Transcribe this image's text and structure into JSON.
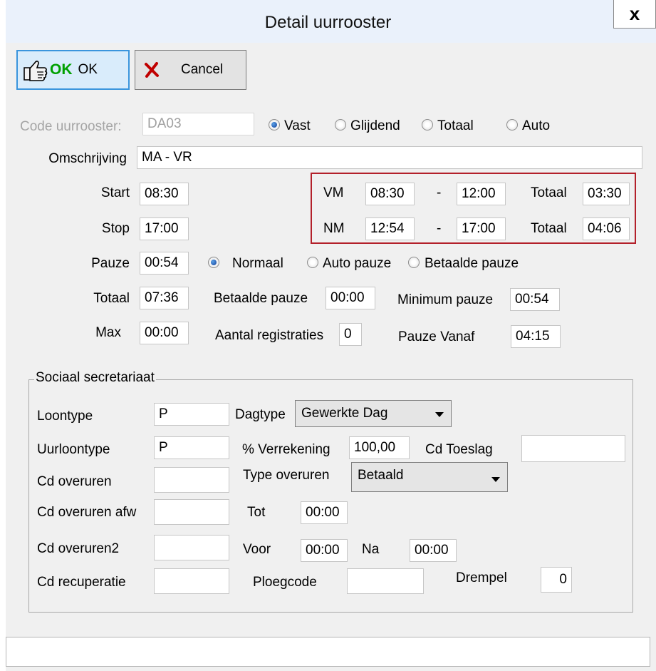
{
  "window": {
    "title": "Detail uurrooster",
    "close": "x"
  },
  "toolbar": {
    "ok_icon_text": "OK",
    "ok_label": "OK",
    "cancel_label": "Cancel"
  },
  "code": {
    "label": "Code uurrooster:",
    "value": "DA03",
    "modes": [
      "Vast",
      "Glijdend",
      "Totaal",
      "Auto"
    ],
    "selected_mode": "Vast"
  },
  "omschrijving": {
    "label": "Omschrijving",
    "value": "MA - VR"
  },
  "start": {
    "label": "Start",
    "value": "08:30"
  },
  "stop": {
    "label": "Stop",
    "value": "17:00"
  },
  "vm": {
    "label": "VM",
    "from": "08:30",
    "sep": "-",
    "to": "12:00",
    "totaal_label": "Totaal",
    "totaal": "03:30"
  },
  "nm": {
    "label": "NM",
    "from": "12:54",
    "sep": "-",
    "to": "17:00",
    "totaal_label": "Totaal",
    "totaal": "04:06"
  },
  "pauze": {
    "label": "Pauze",
    "value": "00:54",
    "options": [
      "Normaal",
      "Auto pauze",
      "Betaalde pauze"
    ],
    "selected": "Normaal"
  },
  "totaal": {
    "label": "Totaal",
    "value": "07:36"
  },
  "betaalde_pauze": {
    "label": "Betaalde pauze",
    "value": "00:00"
  },
  "minimum_pauze": {
    "label": "Minimum pauze",
    "value": "00:54"
  },
  "max": {
    "label": "Max",
    "value": "00:00"
  },
  "aantal_registraties": {
    "label": "Aantal registraties",
    "value": "0"
  },
  "pauze_vanaf": {
    "label": "Pauze Vanaf",
    "value": "04:15"
  },
  "sociaal": {
    "title": "Sociaal secretariaat",
    "loontype": {
      "label": "Loontype",
      "value": "P"
    },
    "dagtype": {
      "label": "Dagtype",
      "value": "Gewerkte Dag"
    },
    "uurloontype": {
      "label": "Uurloontype",
      "value": "P"
    },
    "verrekening": {
      "label": "% Verrekening",
      "value": "100,00"
    },
    "cd_toeslag": {
      "label": "Cd Toeslag",
      "value": ""
    },
    "cd_overuren": {
      "label": "Cd overuren",
      "value": ""
    },
    "type_overuren": {
      "label": "Type overuren",
      "value": "Betaald"
    },
    "cd_overuren_afw": {
      "label": "Cd overuren afw",
      "value": ""
    },
    "tot": {
      "label": "Tot",
      "value": "00:00"
    },
    "cd_overuren2": {
      "label": "Cd overuren2",
      "value": ""
    },
    "voor": {
      "label": "Voor",
      "value": "00:00"
    },
    "na": {
      "label": "Na",
      "value": "00:00"
    },
    "cd_recuperatie": {
      "label": "Cd recuperatie",
      "value": ""
    },
    "ploegcode": {
      "label": "Ploegcode",
      "value": ""
    },
    "drempel": {
      "label": "Drempel",
      "value": "0"
    }
  },
  "status_bar": {
    "text": ""
  },
  "colors": {
    "highlight_border": "#b3202a",
    "ok_button_border": "#3a95dd",
    "ok_icon_text": "#00a000"
  }
}
